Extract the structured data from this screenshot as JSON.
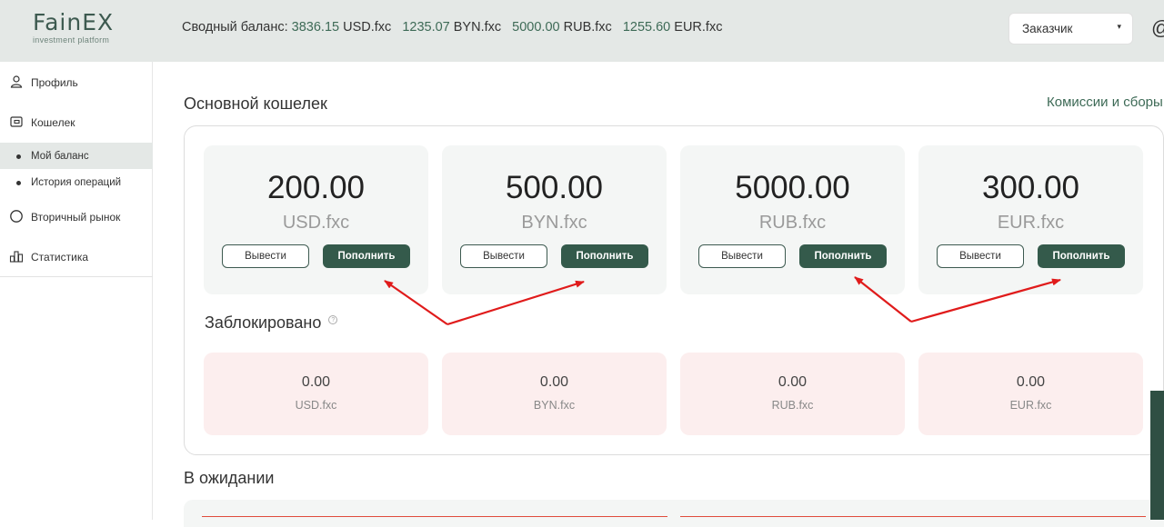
{
  "logo": {
    "title": "FainEX",
    "subtitle": "investment platform"
  },
  "header": {
    "balance_label": "Сводный баланс:",
    "balances": [
      {
        "amount": "3836.15",
        "currency": "USD.fxc"
      },
      {
        "amount": "1235.07",
        "currency": "BYN.fxc"
      },
      {
        "amount": "5000.00",
        "currency": "RUB.fxc"
      },
      {
        "amount": "1255.60",
        "currency": "EUR.fxc"
      }
    ],
    "role_select": "Заказчик",
    "caret_glyph": "▾",
    "user_icon_glyph": "@"
  },
  "sidebar": {
    "items": [
      {
        "label": "Профиль",
        "icon": "person-icon"
      },
      {
        "label": "Кошелек",
        "icon": "wallet-icon"
      },
      {
        "label": "Мой баланс",
        "sub": true,
        "active": true
      },
      {
        "label": "История операций",
        "sub": true
      },
      {
        "label": "Вторичный рынок",
        "icon": "circle-icon"
      },
      {
        "label": "Статистика",
        "icon": "bar-chart-icon"
      }
    ]
  },
  "main": {
    "wallet_title": "Основной кошелек",
    "fees_link": "Комиссии и сборы",
    "withdraw_label": "Вывести",
    "deposit_label": "Пополнить",
    "cards": [
      {
        "amount": "200.00",
        "currency": "USD.fxc"
      },
      {
        "amount": "500.00",
        "currency": "BYN.fxc"
      },
      {
        "amount": "5000.00",
        "currency": "RUB.fxc"
      },
      {
        "amount": "300.00",
        "currency": "EUR.fxc"
      }
    ],
    "blocked_title": "Заблокировано",
    "help_glyph": "?",
    "blocked_cards": [
      {
        "amount": "0.00",
        "currency": "USD.fxc"
      },
      {
        "amount": "0.00",
        "currency": "BYN.fxc"
      },
      {
        "amount": "0.00",
        "currency": "RUB.fxc"
      },
      {
        "amount": "0.00",
        "currency": "EUR.fxc"
      }
    ],
    "pending_title": "В ожидании"
  },
  "colors": {
    "accent": "#345a4b",
    "arrow": "#e01b1b",
    "blocked_bg": "#fceeee"
  }
}
